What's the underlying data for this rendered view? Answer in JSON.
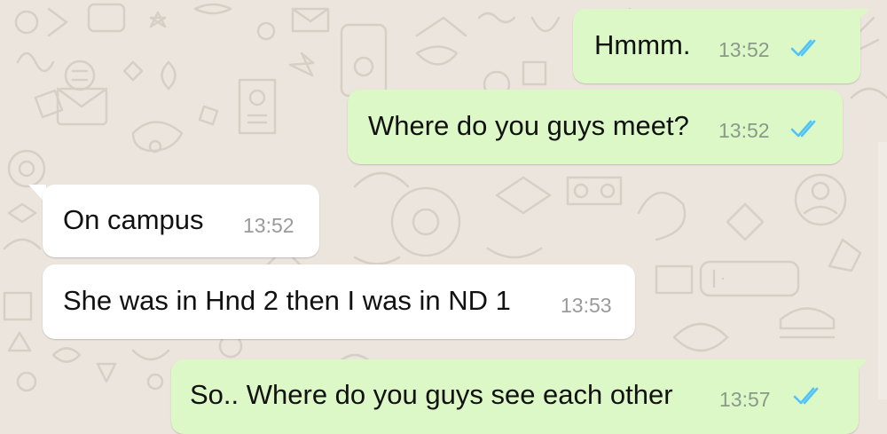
{
  "chat": {
    "messages": [
      {
        "direction": "outgoing",
        "text": "Hmmm.",
        "time": "13:52",
        "status": "read"
      },
      {
        "direction": "outgoing",
        "text": "Where do you guys meet?",
        "time": "13:52",
        "status": "read"
      },
      {
        "direction": "incoming",
        "text": "On campus",
        "time": "13:52"
      },
      {
        "direction": "incoming",
        "text": "She was in Hnd 2 then I was in ND 1",
        "time": "13:53"
      },
      {
        "direction": "outgoing",
        "text": "So.. Where do you guys see each other",
        "time": "13:57",
        "status": "read"
      }
    ]
  },
  "colors": {
    "wallpaper": "#ece5dd",
    "outgoing_bubble": "#dcf8c6",
    "incoming_bubble": "#ffffff",
    "read_ticks": "#4fc3f7"
  },
  "icons": {
    "read_receipt": "double-check-icon"
  }
}
